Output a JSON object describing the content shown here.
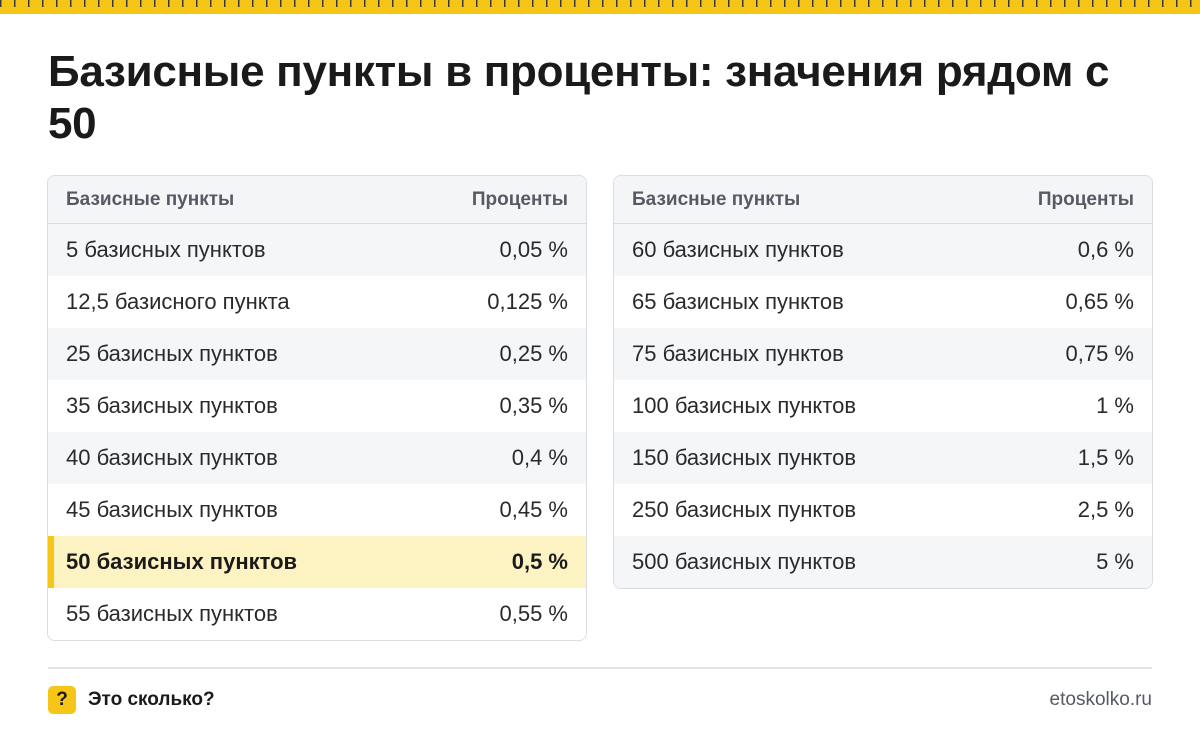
{
  "title": "Базисные пункты в проценты: значения рядом с 50",
  "colors": {
    "accent": "#f5c518",
    "highlight_bg": "#fdf2c2",
    "header_bg": "#f4f5f7",
    "border": "#d9dce1"
  },
  "left_table": {
    "headers": [
      "Базисные пункты",
      "Проценты"
    ],
    "rows": [
      [
        "5 базисных пунктов",
        "0,05 %"
      ],
      [
        "12,5 базисного пункта",
        "0,125 %"
      ],
      [
        "25 базисных пунктов",
        "0,25 %"
      ],
      [
        "35 базисных пунктов",
        "0,35 %"
      ],
      [
        "40 базисных пунктов",
        "0,4 %"
      ],
      [
        "45 базисных пунктов",
        "0,45 %"
      ],
      [
        "50 базисных пунктов",
        "0,5 %"
      ],
      [
        "55 базисных пунктов",
        "0,55 %"
      ]
    ]
  },
  "right_table": {
    "headers": [
      "Базисные пункты",
      "Проценты"
    ],
    "rows": [
      [
        "60 базисных пунктов",
        "0,6 %"
      ],
      [
        "65 базисных пунктов",
        "0,65 %"
      ],
      [
        "75 базисных пунктов",
        "0,75 %"
      ],
      [
        "100 базисных пунктов",
        "1 %"
      ],
      [
        "150 базисных пунктов",
        "1,5 %"
      ],
      [
        "250 базисных пунктов",
        "2,5 %"
      ],
      [
        "500 базисных пунктов",
        "5 %"
      ]
    ]
  },
  "footer": {
    "logo_glyph": "?",
    "brand": "Это сколько?",
    "site": "etoskolko.ru"
  }
}
